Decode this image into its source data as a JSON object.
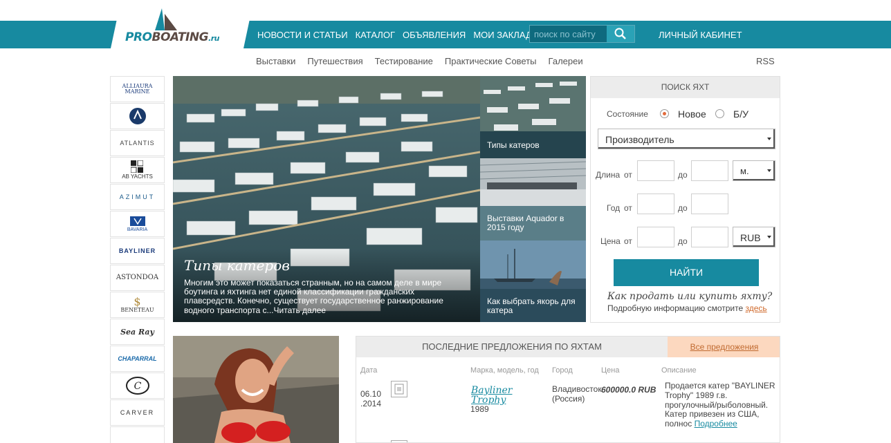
{
  "logo": {
    "pro": "PRO",
    "boating": "BOATING",
    "ru": ".ru"
  },
  "nav": {
    "items": [
      "НОВОСТИ И СТАТЬИ",
      "КАТАЛОГ",
      "ОБЪЯВЛЕНИЯ",
      "МОИ ЗАКЛАДКИ"
    ],
    "search_placeholder": "поиск по сайту",
    "cabinet": "ЛИЧНЫЙ КАБИНЕТ"
  },
  "subnav": {
    "items": [
      "Выставки",
      "Путешествия",
      "Тестирование",
      "Практические Советы",
      "Галереи"
    ],
    "rss": "RSS"
  },
  "brands": [
    "ALLIAURA MARINE",
    "AQUADOR",
    "ATLANTIS",
    "AB YACHTS",
    "AZIMUT",
    "BAVARIA",
    "BAYLINER",
    "ASTONDOA",
    "BENETEAU",
    "Sea Ray",
    "CHAPARRAL",
    "C",
    "CARVER",
    ""
  ],
  "hero": {
    "title": "Типы катеров",
    "text": "Многим это может показаться странным, но на самом деле в мире боутинга и яхтинга нет единой классификации гражданских плавсредств. Конечно, существует государственное ранжирование водного транспорта с...",
    "read_more": "Читать далее"
  },
  "thumbs": [
    {
      "caption": "Типы катеров"
    },
    {
      "caption": "Выставки Aquador в 2015 году"
    },
    {
      "caption": "Как выбрать якорь для катера"
    }
  ],
  "yacht_search": {
    "title": "ПОИСК ЯХТ",
    "state_label": "Состояние",
    "state_new": "Новое",
    "state_used": "Б/У",
    "manufacturer": "Производитель",
    "length_label": "Длина",
    "year_label": "Год",
    "price_label": "Цена",
    "from": "от",
    "to": "до",
    "unit": "м.",
    "currency": "RUB",
    "find": "НАЙТИ",
    "howto": "Как продать или купить яхту?",
    "more_text": "Подробную информацию смотрите",
    "more_link": "здесь"
  },
  "offers": {
    "title": "ПОСЛЕДНИЕ ПРЕДЛОЖЕНИЯ ПО ЯХТАМ",
    "all": "Все предложения",
    "columns": [
      "Дата",
      "Марка, модель, год",
      "Город",
      "Цена",
      "Описание"
    ],
    "rows": [
      {
        "date1": "06.10",
        "date2": ".2014",
        "model1": "Bayliner",
        "model2": "Trophy",
        "year": "1989",
        "city1": "Владивосток",
        "city2": "(Россия)",
        "price": "600000.0 RUB",
        "desc": "Продается катер \"BAYLINER Trophy\" 1989 г.в. прогулочный/рыболовный. Катер привезен из США, полнос",
        "desc_link": "Подробнее"
      }
    ]
  },
  "colors": {
    "accent": "#178aa0",
    "orange": "#e26b3c",
    "offers_all_bg": "#fcd8bf"
  }
}
